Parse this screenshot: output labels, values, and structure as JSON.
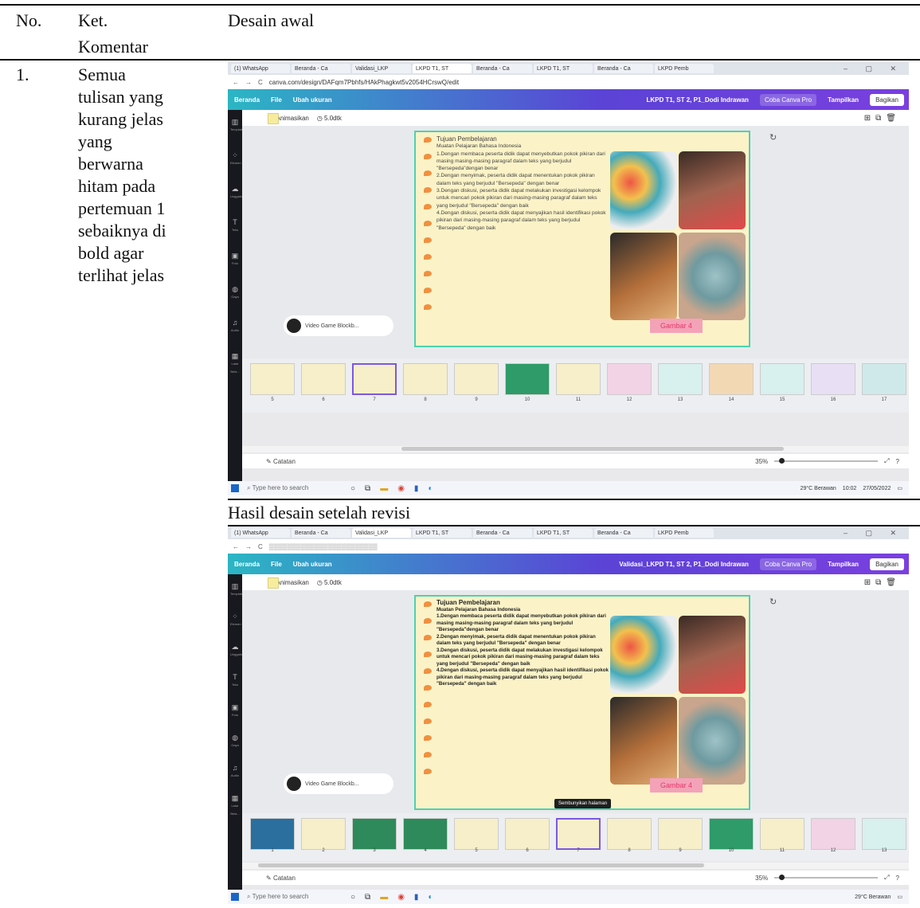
{
  "table": {
    "headers": {
      "no": "No.",
      "ket": "Ket.",
      "ket2": "Komentar",
      "desain": "Desain awal"
    },
    "row": {
      "no": "1.",
      "comment_lines": [
        "Semua",
        "tulisan yang",
        "kurang jelas",
        "yang",
        "berwarna",
        "hitam pada",
        "pertemuan 1",
        "sebaiknya di",
        "bold agar",
        "terlihat jelas"
      ]
    },
    "revised_label": "Hasil desain setelah revisi"
  },
  "screenshot_before": {
    "tabs": [
      "(1) WhatsApp",
      "Beranda - Ca",
      "Validasi_LKP",
      "LKPD T1, ST",
      "Beranda - Ca",
      "LKPD T1, ST",
      "Beranda - Ca",
      "LKPD Pemb"
    ],
    "url": "canva.com/design/DAFqm7Pbhfs/HAkPhagkwt5v2054HCrswQ/edit",
    "topbar": {
      "home": "Beranda",
      "file": "File",
      "resize": "Ubah ukuran",
      "doc_title": "LKPD T1, ST 2, P1_Dodi Indrawan",
      "pro": "Coba Canva Pro",
      "present": "Tampilkan",
      "share": "Bagikan"
    },
    "sidebar": [
      "Template",
      "Elemen",
      "Unggahan",
      "Teks",
      "Foto",
      "Gaya",
      "Audio",
      "Latar Bela..."
    ],
    "toolbar": {
      "animate": "Animasikan",
      "duration": "5.0dtk"
    },
    "slide": {
      "heading": "Tujuan Pembelajaran",
      "subject": "Muatan Pelajaran Bahasa Indonesia",
      "objectives": [
        "1.Dengan membaca peserta didik dapat menyebutkan pokok pikiran dari masing masing-masing paragraf dalam teks yang berjudul \"Bersepeda\"dengan benar",
        "2.Dengan menyimak, peserta didik dapat menentukan pokok pikiran dalam teks yang berjudul \"Bersepeda\" dengan benar",
        "3.Dengan diskusi, peserta didik dapat melakukan investigasi kelompok untuk mencari pokok pikiran dari masing-masing paragraf dalam teks yang berjudul \"Bersepeda\" dengan baik",
        "4.Dengan diskusi, peserta didik dapat menyajikan hasil identifikasi pokok pikiran dari masing-masing paragraf dalam teks yang berjudul \"Bersepeda\" dengan baik"
      ],
      "image_label": "Gambar 4"
    },
    "audio_label": "Video Game Blockb...",
    "thumb_numbers": [
      "5",
      "6",
      "7",
      "8",
      "9",
      "10",
      "11",
      "12",
      "13",
      "14",
      "15",
      "16",
      "17"
    ],
    "notes": "Catatan",
    "zoom": "35%",
    "search": "Type here to search",
    "weather": "29°C Berawan",
    "time": "10:02",
    "date": "27/05/2022"
  },
  "screenshot_after": {
    "topbar": {
      "doc_title": "Validasi_LKPD T1, ST 2, P1_Dodi Indrawan"
    },
    "thumb_numbers": [
      "1",
      "2",
      "3",
      "4",
      "5",
      "6",
      "7",
      "8",
      "9",
      "10",
      "11",
      "12",
      "13"
    ],
    "tooltip": "Sembunyikan halaman"
  },
  "colors": {
    "accent": "#5b43d6",
    "slide_bg": "#fbf3c7",
    "slide_border": "#4fd0b0",
    "gambar": "#f4a2b8"
  }
}
